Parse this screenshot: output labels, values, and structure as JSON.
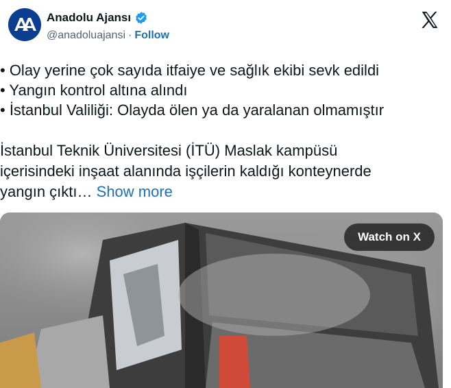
{
  "account": {
    "display_name": "Anadolu Ajansı",
    "handle": "@anadoluajansi",
    "separator": "·",
    "follow_label": "Follow",
    "avatar_icon": "anadolu-agency-logo",
    "verified_icon": "verified-badge-icon",
    "platform_icon": "x-logo-icon",
    "accent_color": "#1d6fb6"
  },
  "tweet": {
    "bullets": [
      "• Olay yerine çok sayıda itfaiye ve sağlık ekibi sevk edildi",
      "• Yangın kontrol altına alındı",
      "• İstanbul Valiliği: Olayda ölen ya da yaralanan olmamıştır"
    ],
    "body_lines": [
      "İstanbul Teknik Üniversitesi (İTÜ) Maslak kampüsü",
      "içerisindeki inşaat alanında işçilerin kaldığı konteynerde",
      "yangın çıktı…"
    ],
    "show_more_label": "Show more"
  },
  "media": {
    "type": "video",
    "watch_label": "Watch on X"
  }
}
